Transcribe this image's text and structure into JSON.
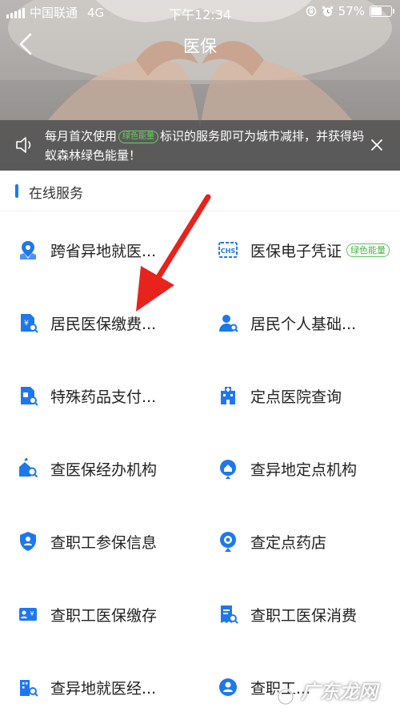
{
  "status_bar": {
    "carrier": "中国联通",
    "network": "4G",
    "time": "下午12:34",
    "battery_text": "57%",
    "battery_level": 0.57
  },
  "nav": {
    "title": "医保",
    "back_icon": "chevron-left-icon"
  },
  "notice": {
    "text_before": "每月首次使用",
    "tag": "绿色能量",
    "text_after": "标识的服务即可为城市减排，并获得蚂蚁森林绿色能量！",
    "close_icon": "close-icon",
    "speaker_icon": "speaker-icon"
  },
  "section": {
    "title": "在线服务",
    "accent_color": "#1e78ec"
  },
  "services": [
    {
      "label": "跨省异地就医...",
      "icon": "map-pin-icon"
    },
    {
      "label": "医保电子凭证",
      "icon": "chs-card-icon",
      "badge": "绿色能量"
    },
    {
      "label": "居民医保缴费...",
      "icon": "payment-doc-icon"
    },
    {
      "label": "居民个人基础...",
      "icon": "person-search-icon"
    },
    {
      "label": "特殊药品支付...",
      "icon": "medicine-doc-icon"
    },
    {
      "label": "定点医院查询",
      "icon": "hospital-icon"
    },
    {
      "label": "查医保经办机构",
      "icon": "agency-icon"
    },
    {
      "label": "查异地定点机构",
      "icon": "location-home-icon"
    },
    {
      "label": "查职工参保信息",
      "icon": "shield-person-icon"
    },
    {
      "label": "查定点药店",
      "icon": "pharmacy-pin-icon"
    },
    {
      "label": "查职工医保缴存",
      "icon": "money-card-icon"
    },
    {
      "label": "查职工医保消费",
      "icon": "receipt-search-icon"
    },
    {
      "label": "查异地就医经...",
      "icon": "building-search-icon"
    },
    {
      "label": "查职工...",
      "icon": "person-circle-icon"
    }
  ],
  "watermark": {
    "text": "广东龙网"
  }
}
